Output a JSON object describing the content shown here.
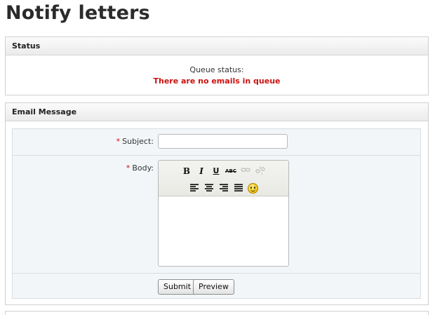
{
  "page": {
    "title": "Notify letters"
  },
  "status": {
    "header": "Status",
    "queue_label": "Queue status:",
    "queue_message": "There are no emails in queue",
    "message_color": "#cc1111"
  },
  "email": {
    "header": "Email Message",
    "required_mark": "*",
    "subject_label": "Subject:",
    "subject_value": "",
    "body_label": "Body:",
    "body_value": "",
    "toolbar": {
      "bold": "B",
      "italic": "I",
      "underline": "U",
      "strikethrough": "ABC",
      "link_icon": "link-icon",
      "unlink_icon": "unlink-icon",
      "align_left_icon": "align-left-icon",
      "align_center_icon": "align-center-icon",
      "align_right_icon": "align-right-icon",
      "justify_icon": "justify-icon",
      "emoticon_icon": "smiley-icon"
    },
    "submit_label": "Submit",
    "preview_label": "Preview"
  }
}
